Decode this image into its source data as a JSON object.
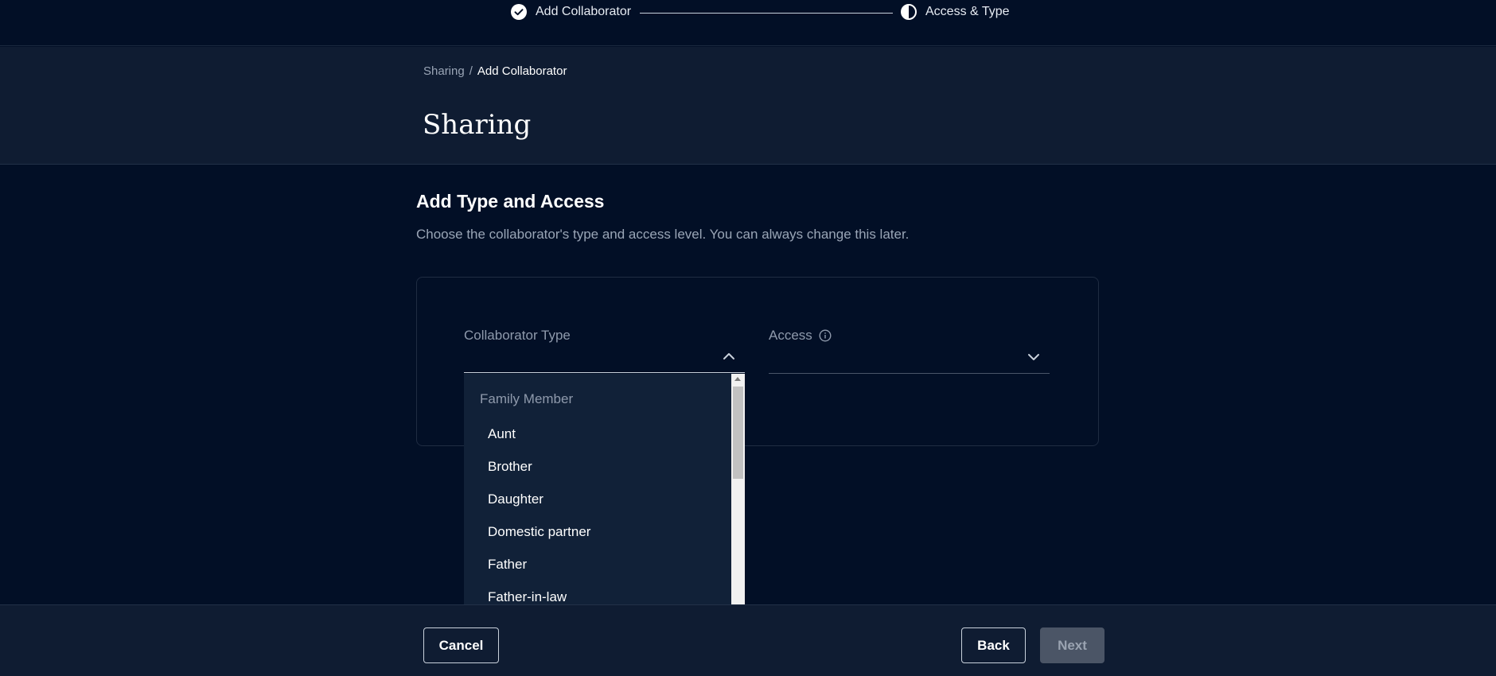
{
  "stepper": {
    "steps": [
      {
        "label": "Add Collaborator",
        "state": "complete",
        "icon": "check-circle-icon"
      },
      {
        "label": "Access & Type",
        "state": "current",
        "icon": "half-circle-icon"
      }
    ]
  },
  "breadcrumb": {
    "parent": "Sharing",
    "separator": "/",
    "current": "Add Collaborator"
  },
  "page_title": "Sharing",
  "section": {
    "title": "Add Type and Access",
    "description": "Choose the collaborator's type and access level. You can always change this later."
  },
  "form": {
    "collaborator_type": {
      "label": "Collaborator Type",
      "value": "",
      "expanded": true,
      "icon": "chevron-up-icon"
    },
    "access": {
      "label": "Access",
      "value": "",
      "info_icon": "info-icon",
      "icon": "chevron-down-icon"
    }
  },
  "dropdown": {
    "group_label": "Family Member",
    "options": [
      "Aunt",
      "Brother",
      "Daughter",
      "Domestic partner",
      "Father",
      "Father-in-law"
    ]
  },
  "footer": {
    "cancel_label": "Cancel",
    "back_label": "Back",
    "next_label": "Next",
    "next_disabled": true
  },
  "colors": {
    "background": "#020f26",
    "header_background": "#0f1c32",
    "dropdown_background": "#112138",
    "text_muted": "#9aa5b6",
    "disabled_button": "#4b5566"
  }
}
